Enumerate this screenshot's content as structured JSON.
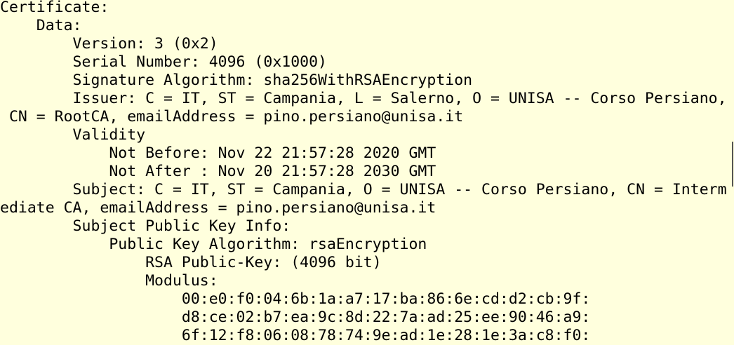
{
  "terminal": {
    "lines": [
      "Certificate:",
      "    Data:",
      "        Version: 3 (0x2)",
      "        Serial Number: 4096 (0x1000)",
      "        Signature Algorithm: sha256WithRSAEncryption",
      "        Issuer: C = IT, ST = Campania, L = Salerno, O = UNISA -- Corso Persiano,",
      " CN = RootCA, emailAddress = pino.persiano@unisa.it",
      "        Validity",
      "            Not Before: Nov 22 21:57:28 2020 GMT",
      "            Not After : Nov 20 21:57:28 2030 GMT",
      "        Subject: C = IT, ST = Campania, O = UNISA -- Corso Persiano, CN = Interm",
      "ediate CA, emailAddress = pino.persiano@unisa.it",
      "        Subject Public Key Info:",
      "            Public Key Algorithm: rsaEncryption",
      "                RSA Public-Key: (4096 bit)",
      "                Modulus:",
      "                    00:e0:f0:04:6b:1a:a7:17:ba:86:6e:cd:d2:cb:9f:",
      "                    d8:ce:02:b7:ea:9c:8d:22:7a:ad:25:ee:90:46:a9:",
      "                    6f:12:f8:06:08:78:74:9e:ad:1e:28:1e:3a:c8:f0:"
    ],
    "colors": {
      "background": "#ffffdd",
      "text": "#000000"
    }
  }
}
